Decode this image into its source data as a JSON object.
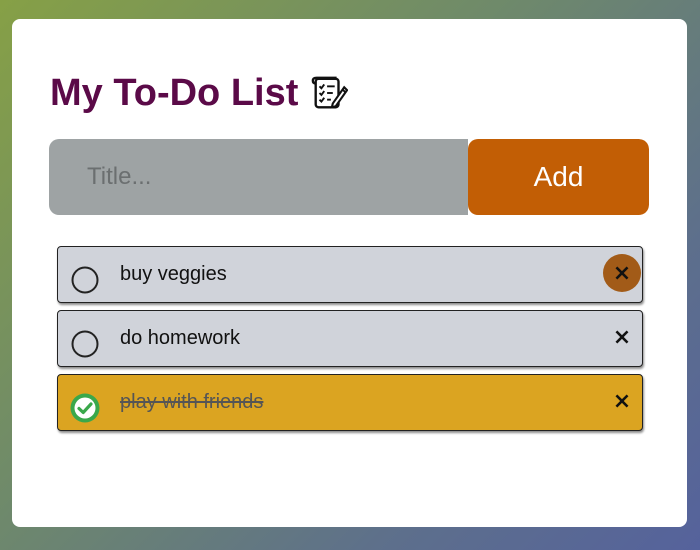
{
  "app": {
    "title": "My To-Do List"
  },
  "new_task": {
    "placeholder": "Title...",
    "value": "",
    "add_label": "Add"
  },
  "tasks": [
    {
      "text": "buy veggies",
      "completed": false,
      "delete_label": "×"
    },
    {
      "text": "do homework",
      "completed": false,
      "delete_label": "×"
    },
    {
      "text": "play with friends",
      "completed": true,
      "delete_label": "×"
    }
  ],
  "colors": {
    "title": "#5b0a48",
    "add_button": "#c25e05",
    "input_bg": "#9ea3a4",
    "task_bg": "#d0d3da",
    "task_done_bg": "#dba421",
    "check_done": "#3aa84b",
    "delete_hover": "#a25b18"
  },
  "icons": {
    "title_icon": "memo-checklist-icon",
    "unchecked": "empty-circle-icon",
    "checked": "check-circle-icon",
    "delete": "close-icon"
  }
}
